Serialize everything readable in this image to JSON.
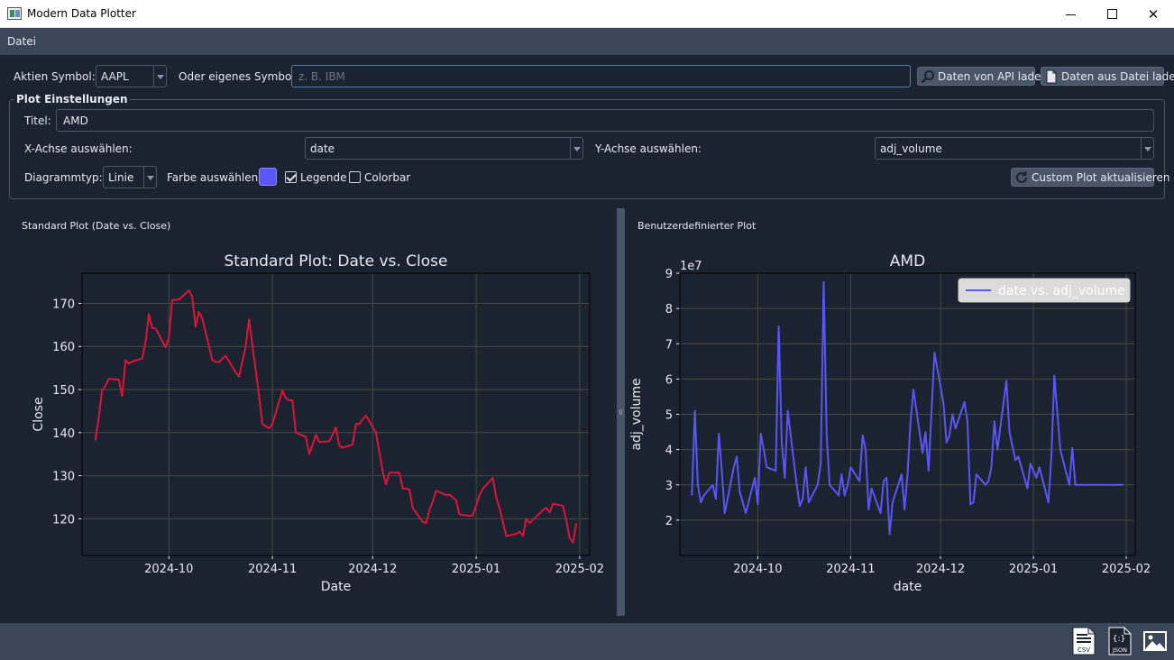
{
  "window": {
    "title": "Modern Data Plotter",
    "minimize": "—",
    "maximize": "☐",
    "close": "✕"
  },
  "menu": {
    "items": [
      "Datei"
    ]
  },
  "toolbar": {
    "symbol_label": "Aktien Symbol:",
    "symbol_value": "AAPL",
    "custom_label": "Oder eigenes Symbol:",
    "custom_placeholder": "z. B. IBM",
    "api_button": "Daten von API laden",
    "file_button": "Daten aus Datei laden"
  },
  "plot_settings": {
    "group_title": "Plot Einstellungen",
    "title_label": "Titel:",
    "title_value": "AMD",
    "x_label": "X-Achse auswählen:",
    "x_value": "date",
    "y_label": "Y-Achse auswählen:",
    "y_value": "adj_volume",
    "type_label": "Diagrammtyp:",
    "type_value": "Linie",
    "color_label": "Farbe auswählen:",
    "color": "#5b55f5",
    "legend_label": "Legende",
    "legend_checked": true,
    "colorbar_label": "Colorbar",
    "colorbar_checked": false,
    "update_button": "Custom Plot aktualisieren"
  },
  "panels": {
    "left_label": "Standard Plot (Date vs. Close)",
    "right_label": "Benutzerdefinierter Plot"
  },
  "status_icons": {
    "csv": "CSV",
    "json": "JSON",
    "image": "image-icon"
  },
  "chart_data": [
    {
      "type": "line",
      "title": "Standard Plot: Date vs. Close",
      "xlabel": "Date",
      "ylabel": "Close",
      "color": "#dc143c",
      "grid": true,
      "legend": false,
      "xlim": [
        "2024-09-05",
        "2025-02-04"
      ],
      "ylim": [
        111.5,
        177
      ],
      "yticks": [
        120,
        130,
        140,
        150,
        160,
        170
      ],
      "xticks": [
        "2024-10",
        "2024-11",
        "2024-12",
        "2025-01",
        "2025-02"
      ],
      "x": [
        "2024-09-09",
        "2024-09-10",
        "2024-09-11",
        "2024-09-12",
        "2024-09-13",
        "2024-09-16",
        "2024-09-17",
        "2024-09-18",
        "2024-09-19",
        "2024-09-20",
        "2024-09-23",
        "2024-09-24",
        "2024-09-25",
        "2024-09-26",
        "2024-09-27",
        "2024-09-30",
        "2024-10-01",
        "2024-10-02",
        "2024-10-03",
        "2024-10-04",
        "2024-10-07",
        "2024-10-08",
        "2024-10-09",
        "2024-10-10",
        "2024-10-11",
        "2024-10-14",
        "2024-10-15",
        "2024-10-16",
        "2024-10-17",
        "2024-10-18",
        "2024-10-21",
        "2024-10-22",
        "2024-10-23",
        "2024-10-24",
        "2024-10-25",
        "2024-10-28",
        "2024-10-29",
        "2024-10-30",
        "2024-10-31",
        "2024-11-01",
        "2024-11-04",
        "2024-11-05",
        "2024-11-06",
        "2024-11-07",
        "2024-11-08",
        "2024-11-11",
        "2024-11-12",
        "2024-11-13",
        "2024-11-14",
        "2024-11-15",
        "2024-11-18",
        "2024-11-19",
        "2024-11-20",
        "2024-11-21",
        "2024-11-22",
        "2024-11-25",
        "2024-11-26",
        "2024-11-27",
        "2024-11-29",
        "2024-12-02",
        "2024-12-03",
        "2024-12-04",
        "2024-12-05",
        "2024-12-06",
        "2024-12-09",
        "2024-12-10",
        "2024-12-11",
        "2024-12-12",
        "2024-12-13",
        "2024-12-16",
        "2024-12-17",
        "2024-12-18",
        "2024-12-19",
        "2024-12-20",
        "2024-12-23",
        "2024-12-24",
        "2024-12-26",
        "2024-12-27",
        "2024-12-30",
        "2024-12-31",
        "2025-01-02",
        "2025-01-03",
        "2025-01-06",
        "2025-01-07",
        "2025-01-08",
        "2025-01-10",
        "2025-01-13",
        "2025-01-14",
        "2025-01-15",
        "2025-01-16",
        "2025-01-17",
        "2025-01-21",
        "2025-01-22",
        "2025-01-23",
        "2025-01-24",
        "2025-01-27",
        "2025-01-28",
        "2025-01-29",
        "2025-01-30",
        "2025-01-31"
      ],
      "y": [
        138.2,
        143.5,
        149.8,
        150.8,
        152.5,
        152.3,
        148.5,
        156.8,
        156.0,
        156.5,
        157.2,
        161.0,
        167.5,
        164.3,
        164.2,
        159.8,
        162.0,
        170.8,
        170.8,
        170.9,
        173.0,
        171.5,
        164.5,
        168.0,
        166.5,
        156.8,
        156.4,
        156.3,
        157.2,
        157.8,
        154.0,
        153.0,
        156.5,
        160.0,
        166.3,
        148.5,
        142.0,
        141.5,
        141.0,
        142.0,
        149.8,
        148.0,
        147.5,
        147.5,
        140.0,
        139.0,
        135.0,
        137.2,
        139.5,
        137.8,
        138.0,
        139.5,
        141.2,
        137.0,
        136.5,
        137.2,
        142.0,
        142.0,
        144.0,
        140.0,
        135.5,
        131.0,
        128.0,
        130.7,
        130.7,
        127.0,
        127.0,
        126.8,
        122.5,
        119.3,
        119.0,
        122.0,
        124.0,
        126.5,
        125.5,
        125.6,
        124.3,
        121.0,
        120.7,
        120.8,
        125.5,
        127.0,
        129.5,
        125.0,
        122.5,
        116.0,
        116.5,
        117.0,
        116.0,
        120.0,
        119.0,
        122.0,
        122.5,
        121.5,
        123.5,
        123.0,
        119.5,
        115.5,
        114.5,
        119.0,
        115.5
      ]
    },
    {
      "type": "line",
      "title": "AMD",
      "xlabel": "date",
      "ylabel": "adj_volume",
      "scale_label": "1e7",
      "color": "#5b55f5",
      "grid": true,
      "legend": true,
      "legend_position": "top-right",
      "series": [
        {
          "name": "date vs. adj_volume"
        }
      ],
      "xlim": [
        "2024-09-05",
        "2025-02-04"
      ],
      "ylim": [
        1.0,
        9.0
      ],
      "yticks": [
        2,
        3,
        4,
        5,
        6,
        7,
        8,
        9
      ],
      "xticks": [
        "2024-10",
        "2024-11",
        "2024-12",
        "2025-01",
        "2025-02"
      ],
      "x": [
        "2024-09-09",
        "2024-09-10",
        "2024-09-11",
        "2024-09-12",
        "2024-09-13",
        "2024-09-16",
        "2024-09-17",
        "2024-09-18",
        "2024-09-19",
        "2024-09-20",
        "2024-09-23",
        "2024-09-24",
        "2024-09-25",
        "2024-09-26",
        "2024-09-27",
        "2024-09-30",
        "2024-10-01",
        "2024-10-02",
        "2024-10-03",
        "2024-10-04",
        "2024-10-07",
        "2024-10-08",
        "2024-10-09",
        "2024-10-10",
        "2024-10-11",
        "2024-10-14",
        "2024-10-15",
        "2024-10-16",
        "2024-10-17",
        "2024-10-18",
        "2024-10-21",
        "2024-10-22",
        "2024-10-23",
        "2024-10-24",
        "2024-10-25",
        "2024-10-28",
        "2024-10-29",
        "2024-10-30",
        "2024-10-31",
        "2024-11-01",
        "2024-11-04",
        "2024-11-05",
        "2024-11-06",
        "2024-11-07",
        "2024-11-08",
        "2024-11-11",
        "2024-11-12",
        "2024-11-13",
        "2024-11-14",
        "2024-11-15",
        "2024-11-18",
        "2024-11-19",
        "2024-11-20",
        "2024-11-21",
        "2024-11-22",
        "2024-11-25",
        "2024-11-26",
        "2024-11-27",
        "2024-11-29",
        "2024-12-02",
        "2024-12-03",
        "2024-12-04",
        "2024-12-05",
        "2024-12-06",
        "2024-12-09",
        "2024-12-10",
        "2024-12-11",
        "2024-12-12",
        "2024-12-13",
        "2024-12-16",
        "2024-12-17",
        "2024-12-18",
        "2024-12-19",
        "2024-12-20",
        "2024-12-23",
        "2024-12-24",
        "2024-12-26",
        "2024-12-27",
        "2024-12-30",
        "2024-12-31",
        "2025-01-02",
        "2025-01-03",
        "2025-01-06",
        "2025-01-07",
        "2025-01-08",
        "2025-01-10",
        "2025-01-13",
        "2025-01-14",
        "2025-01-15",
        "2025-01-16",
        "2025-01-17",
        "2025-01-21",
        "2025-01-22",
        "2025-01-23",
        "2025-01-24",
        "2025-01-27",
        "2025-01-28",
        "2025-01-29",
        "2025-01-30",
        "2025-01-31"
      ],
      "y": [
        2.7,
        5.1,
        3.0,
        2.5,
        2.7,
        3.0,
        2.6,
        4.45,
        3.4,
        2.2,
        3.5,
        3.8,
        2.8,
        2.5,
        2.2,
        3.2,
        2.45,
        4.45,
        4.0,
        3.5,
        3.4,
        7.5,
        4.2,
        3.2,
        5.1,
        3.0,
        2.4,
        2.6,
        3.5,
        2.5,
        3.0,
        3.6,
        8.75,
        4.4,
        3.0,
        2.7,
        3.3,
        2.7,
        3.0,
        3.5,
        3.1,
        4.4,
        4.0,
        2.3,
        2.9,
        2.2,
        3.1,
        3.2,
        1.6,
        2.5,
        3.3,
        2.3,
        3.3,
        4.8,
        5.7,
        3.9,
        4.5,
        3.4,
        6.75,
        5.3,
        4.2,
        4.4,
        5.0,
        4.6,
        5.35,
        4.8,
        2.45,
        2.5,
        3.3,
        3.0,
        3.1,
        3.5,
        4.8,
        4.0,
        5.95,
        4.5,
        3.7,
        3.8,
        2.9,
        3.6,
        3.2,
        3.5,
        2.5,
        3.8,
        6.1,
        4.0,
        3.0,
        4.05,
        3.0,
        3.0,
        3.0,
        3.0,
        3.0,
        3.0,
        3.0,
        3.0,
        3.0,
        3.0,
        3.0,
        3.0
      ]
    }
  ]
}
